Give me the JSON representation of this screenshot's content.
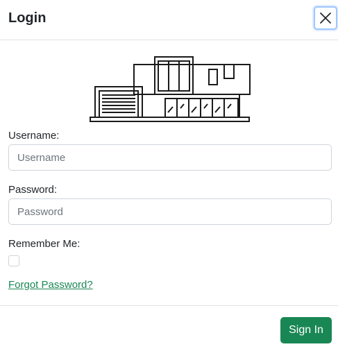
{
  "modal": {
    "title": "Login",
    "close_icon": "close-icon"
  },
  "illustration": {
    "icon": "building-illustration"
  },
  "form": {
    "username_label": "Username:",
    "username_placeholder": "Username",
    "username_value": "",
    "password_label": "Password:",
    "password_placeholder": "Password",
    "password_value": "",
    "remember_label": "Remember Me:",
    "remember_checked": false,
    "forgot_link": "Forgot Password?"
  },
  "footer": {
    "signin_label": "Sign In"
  },
  "colors": {
    "primary_green": "#198754",
    "border": "#ced4da",
    "divider": "#dee2e6",
    "focus_ring": "#9ec5fe"
  }
}
